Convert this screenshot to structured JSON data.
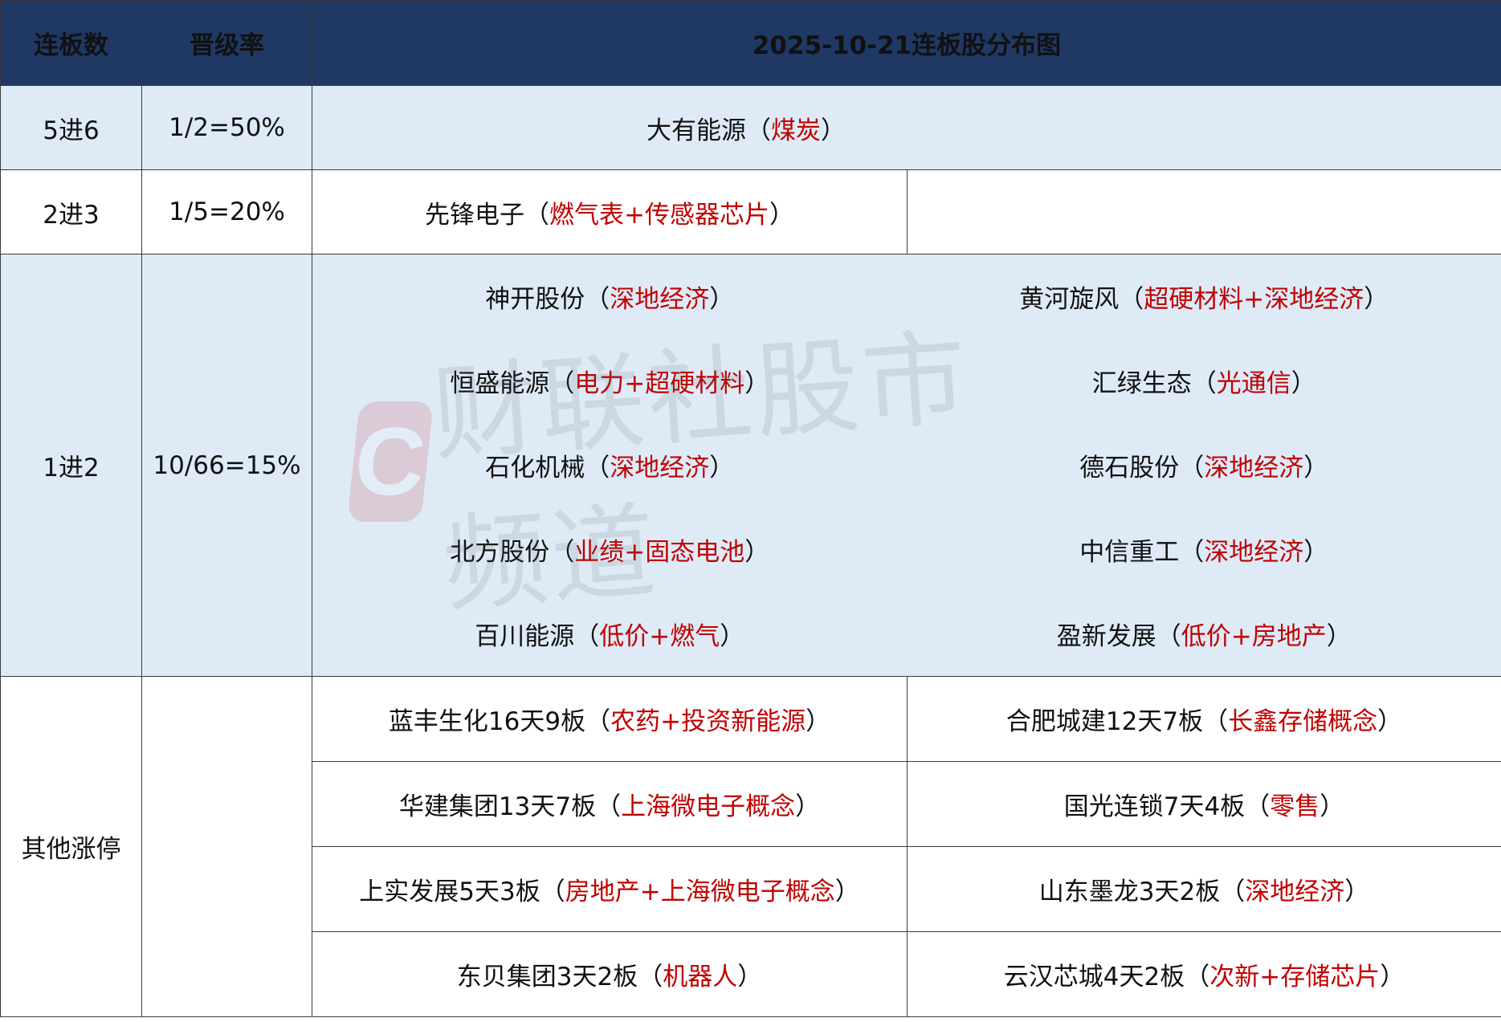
{
  "header": {
    "col_boards": "连板数",
    "col_rate": "晋级率",
    "col_title": "2025-10-21连板股分布图"
  },
  "rows": {
    "r5to6": {
      "label": "5进6",
      "rate": "1/2=50%",
      "entries": [
        {
          "stock": "大有能源",
          "open": "（",
          "concept": "煤炭",
          "close": "）"
        }
      ]
    },
    "r2to3": {
      "label": "2进3",
      "rate": "1/5=20%",
      "entries": [
        {
          "stock": "先锋电子",
          "open": "（",
          "concept": "燃气表+传感器芯片",
          "close": "）"
        }
      ]
    },
    "r1to2": {
      "label": "1进2",
      "rate": "10/66=15%",
      "entries": [
        {
          "stock": "神开股份",
          "open": "（",
          "concept": "深地经济",
          "close": "）"
        },
        {
          "stock": "黄河旋风",
          "open": "（",
          "concept": "超硬材料+深地经济",
          "close": "）"
        },
        {
          "stock": "恒盛能源",
          "open": "（",
          "concept": "电力+超硬材料",
          "close": "）"
        },
        {
          "stock": "汇绿生态",
          "open": "（",
          "concept": "光通信",
          "close": "）"
        },
        {
          "stock": "石化机械",
          "open": "（",
          "concept": "深地经济",
          "close": "）"
        },
        {
          "stock": "德石股份",
          "open": "（",
          "concept": "深地经济",
          "close": "）"
        },
        {
          "stock": "北方股份",
          "open": "（",
          "concept": "业绩+固态电池",
          "close": "）"
        },
        {
          "stock": "中信重工",
          "open": "（",
          "concept": "深地经济",
          "close": "）"
        },
        {
          "stock": "百川能源",
          "open": "（",
          "concept": "低价+燃气",
          "close": "）"
        },
        {
          "stock": "盈新发展",
          "open": "（",
          "concept": "低价+房地产",
          "close": "）"
        }
      ]
    },
    "others": {
      "label": "其他涨停",
      "rate": "",
      "entries": [
        {
          "stock": "蓝丰生化16天9板",
          "open": "（",
          "concept": "农药+投资新能源",
          "close": "）"
        },
        {
          "stock": "合肥城建12天7板",
          "open": "（",
          "concept": "长鑫存储概念",
          "close": "）"
        },
        {
          "stock": "华建集团13天7板",
          "open": "（",
          "concept": "上海微电子概念",
          "close": "）"
        },
        {
          "stock": "国光连锁7天4板",
          "open": "（",
          "concept": "零售",
          "close": "）"
        },
        {
          "stock": "上实发展5天3板",
          "open": "（",
          "concept": "房地产+上海微电子概念",
          "close": "）"
        },
        {
          "stock": "山东墨龙3天2板",
          "open": "（",
          "concept": "深地经济",
          "close": "）"
        },
        {
          "stock": "东贝集团3天2板",
          "open": "（",
          "concept": "机器人",
          "close": "）"
        },
        {
          "stock": "云汉芯城4天2板",
          "open": "（",
          "concept": "次新+存储芯片",
          "close": "）"
        }
      ]
    }
  },
  "watermark": {
    "logo_letter": "C",
    "text": "财联社股市频道"
  },
  "colors": {
    "header_bg": "#1f3864",
    "shade_bg": "#deebf7",
    "concept_red": "#c00000"
  }
}
